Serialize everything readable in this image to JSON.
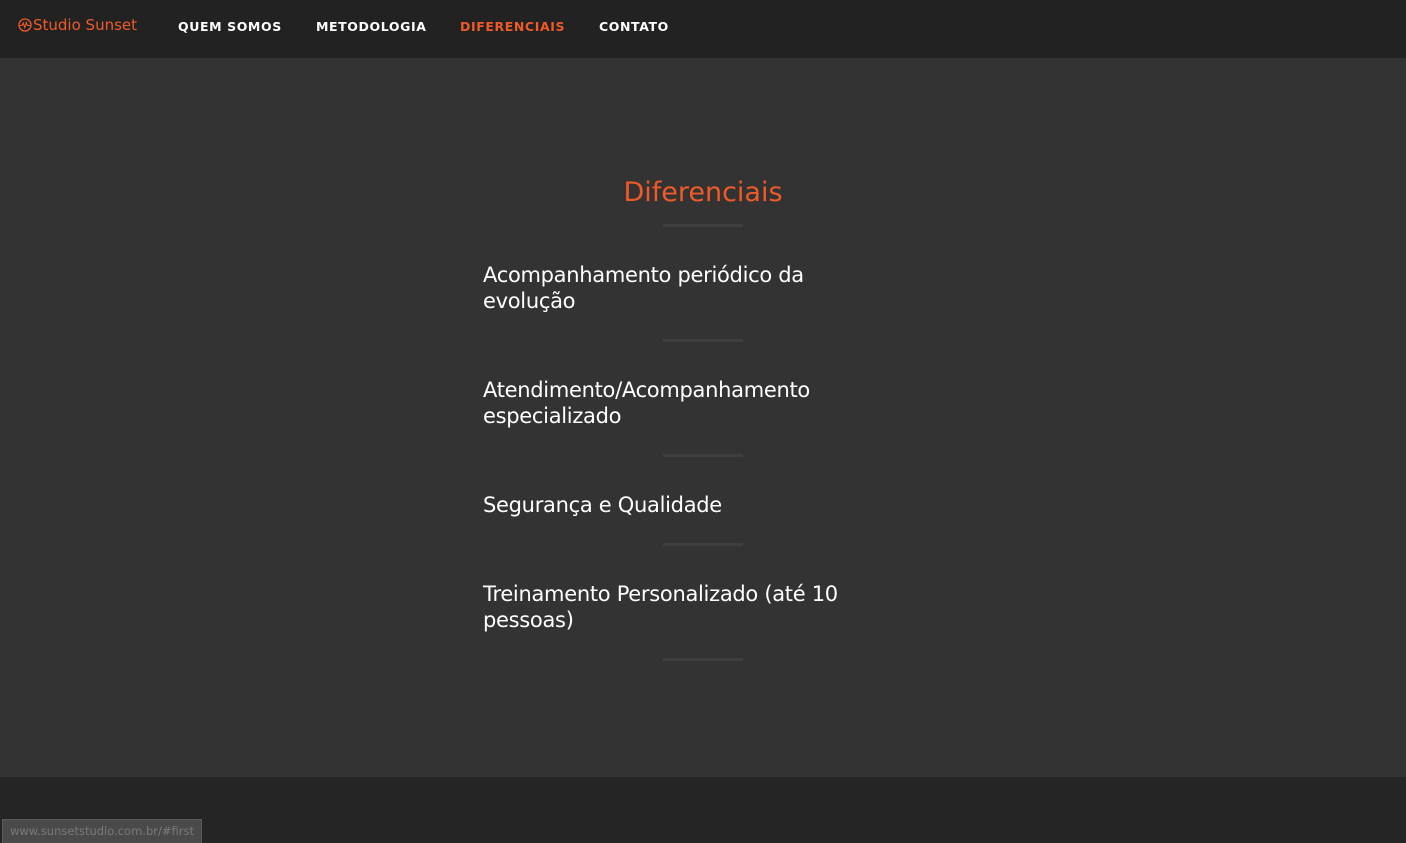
{
  "nav": {
    "brand": "Studio Sunset",
    "brand_icon": "heartbeat-circle-icon",
    "links": [
      {
        "label": "QUEM SOMOS"
      },
      {
        "label": "METODOLOGIA"
      },
      {
        "label": "DIFERENCIAIS",
        "active": true
      },
      {
        "label": "CONTATO"
      }
    ]
  },
  "section": {
    "title": "Diferenciais",
    "items": [
      "Acompanhamento periódico da evolução",
      "Atendimento/Acompanhamento especializado",
      "Segurança e Qualidade",
      "Treinamento Personalizado (até 10 pessoas)"
    ]
  },
  "status_bar": {
    "url": "www.sunsetstudio.com.br/#first"
  },
  "colors": {
    "accent": "#f05a28",
    "navbar": "#222222",
    "section_bg": "#333333",
    "footer_bg": "#252525"
  }
}
